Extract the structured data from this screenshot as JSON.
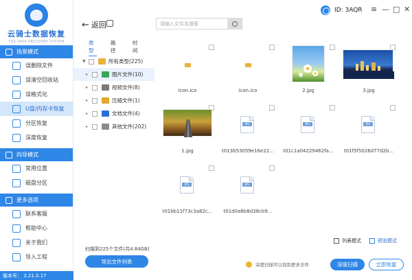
{
  "brand": {
    "name": "云骑士数据恢复",
    "subtitle": "YQS DATA RECOVERY SYSTEM"
  },
  "sidebar": {
    "sections": [
      {
        "title": "场景模式",
        "items": [
          "误删除文件",
          "误清空回收站",
          "误格式化",
          "U盘/内存卡恢复",
          "分区恢复",
          "深度恢复"
        ]
      },
      {
        "title": "向导模式",
        "items": [
          "常用位置",
          "磁盘分区"
        ]
      },
      {
        "title": "更多选项",
        "items": [
          "联系客服",
          "帮助中心",
          "关于我们",
          "导入工程"
        ]
      }
    ],
    "active_item": "U盘/内存卡恢复",
    "version": "版本号： 3.21.0.17"
  },
  "topbar": {
    "back_label": "返回",
    "search_placeholder": "请输入文件名搜索",
    "id_label": "ID: 3AQR",
    "controls": [
      "≡",
      "—",
      "□",
      "✕"
    ]
  },
  "tree": {
    "tabs": [
      "类型",
      "路径",
      "时间"
    ],
    "active_tab": "类型",
    "root": "所有类型(225)",
    "children": [
      {
        "label": "图片文件(10)",
        "color": "#3aa657"
      },
      {
        "label": "视频文件(8)",
        "color": "#7b7b7b"
      },
      {
        "label": "压缩文件(1)",
        "color": "#e2a72e"
      },
      {
        "label": "文档文件(4)",
        "color": "#2b6fd6"
      },
      {
        "label": "其他文件(202)",
        "color": "#8c8c8c"
      }
    ]
  },
  "files": [
    {
      "name": "icon.ico",
      "kind": "folder"
    },
    {
      "name": "icon.ico",
      "kind": "folder"
    },
    {
      "name": "2.jpg",
      "kind": "photo-flower"
    },
    {
      "name": "3.jpg",
      "kind": "photo-city"
    },
    {
      "name": "1.jpg",
      "kind": "photo-road"
    },
    {
      "name": "t013b53059e16e22...",
      "kind": "doc",
      "tag": "JPG"
    },
    {
      "name": "t01c1a04229462fa...",
      "kind": "doc",
      "tag": "JPG"
    },
    {
      "name": "t01f5f5026d77d2b...",
      "kind": "doc",
      "tag": "JPG"
    },
    {
      "name": "t01bb11f73c3a82c...",
      "kind": "doc",
      "tag": "JPG"
    },
    {
      "name": "t01d0a6b8d38cb9...",
      "kind": "doc",
      "tag": "JPG"
    }
  ],
  "footer": {
    "scanned": "扫描到225个文件(共4.84GB)",
    "export_label": "导出文件列表",
    "list_mode": "列表模式",
    "preview_mode": "预览模式",
    "tip": "深度扫描可以找到更多文件",
    "deep_scan": "深度扫描",
    "recover_now": "立即恢复"
  },
  "colors": {
    "accent": "#2e86e6",
    "active_bg": "#d4e6fa"
  }
}
